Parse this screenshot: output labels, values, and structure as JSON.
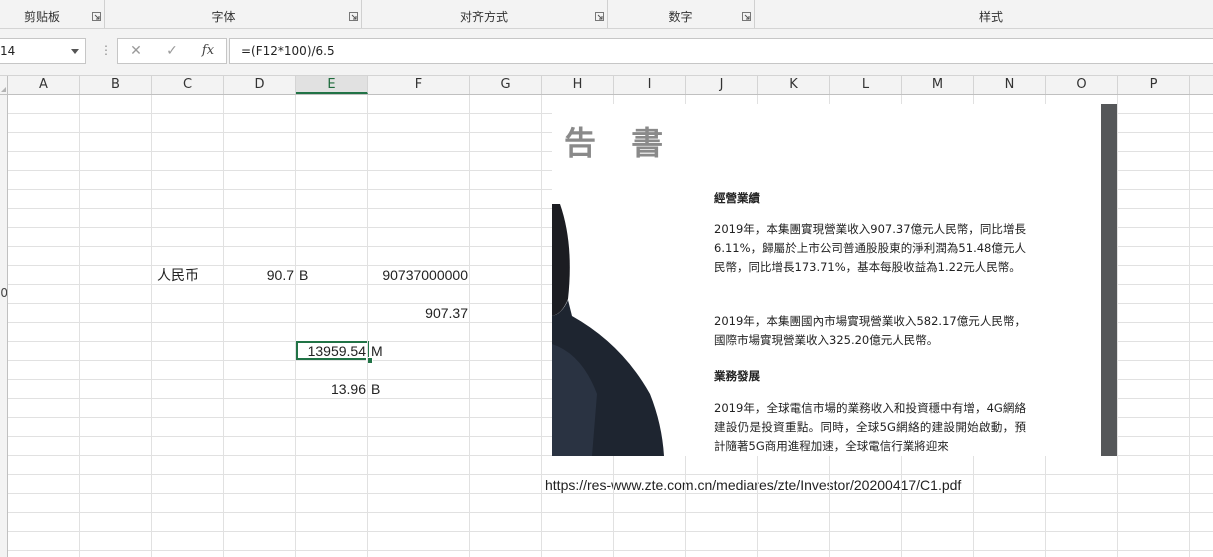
{
  "ribbon": {
    "groups": [
      {
        "label": "剪贴板"
      },
      {
        "label": "字体"
      },
      {
        "label": "对齐方式"
      },
      {
        "label": "数字"
      },
      {
        "label": "样式"
      }
    ]
  },
  "formula_bar": {
    "name_box": "14",
    "cancel_symbol": "✕",
    "enter_symbol": "✓",
    "fx_label": "fx",
    "formula": "=(F12*100)/6.5"
  },
  "columns": [
    "A",
    "B",
    "C",
    "D",
    "E",
    "F",
    "G",
    "H",
    "I",
    "J",
    "K",
    "L",
    "M",
    "N",
    "O",
    "P"
  ],
  "selected_column": "E",
  "row_labels": [
    "",
    "",
    "",
    "",
    "",
    "",
    "",
    "",
    "",
    "",
    "0",
    "",
    "",
    "",
    "",
    "",
    "",
    "",
    "",
    "",
    "",
    "",
    "",
    "",
    ""
  ],
  "cells": {
    "c_rmb": "人民币",
    "d_value": "90.7",
    "d_unit": "B",
    "f_full": "90737000000",
    "f_short": "907.37",
    "e_selected": "13959.54",
    "e_selected_unit": "M",
    "e_b": "13.96",
    "e_b_unit": "B"
  },
  "picture": {
    "title": "告 書",
    "section1_heading": "經營業績",
    "para1": "2019年，本集團實現營業收入907.37億元人民幣，同比增長6.11%，歸屬於上市公司普通股股東的淨利潤為51.48億元人民幣，同比增長173.71%，基本每股收益為1.22元人民幣。",
    "para2": "2019年，本集團國內市場實現營業收入582.17億元人民幣，國際市場實現營業收入325.20億元人民幣。",
    "section2_heading": "業務發展",
    "para3": "2019年，全球電信市場的業務收入和投資穩中有增，4G網絡建設仍是投資重點。同時，全球5G網絡的建設開始啟動，預計隨著5G商用進程加速，全球電信行業將迎來"
  },
  "url_text": "https://res-www.zte.com.cn/mediares/zte/Investor/20200417/C1.pdf",
  "colors": {
    "accent_green": "#217346",
    "scrollbar": "#555759"
  }
}
